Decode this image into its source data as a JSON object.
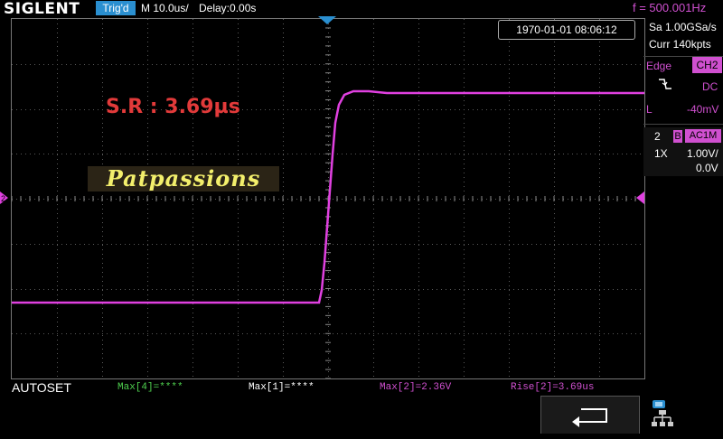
{
  "header": {
    "logo_text": "SIGLENT",
    "trigger_status": "Trig'd",
    "timebase": "M 10.0us/",
    "delay": "Delay:0.00s",
    "frequency": "f = 500.001Hz"
  },
  "screen": {
    "datetime": "1970-01-01 08:06:12",
    "annotation": "S.R : 3.69µs",
    "watermark": "Patpassions",
    "trace_color": "#e040e0",
    "grid_color": "#5a5a5a"
  },
  "right_panel": {
    "sample_rate": "Sa 1.00GSa/s",
    "memory_depth": "Curr 140kpts",
    "trigger": {
      "type_label": "Edge",
      "source": "CH2",
      "slope_icon": "falling-edge-icon",
      "coupling": "DC",
      "level_label": "L",
      "level_value": "-40mV"
    },
    "channel": {
      "number": "2",
      "bw_limit": "B",
      "coupling": "AC1M",
      "probe": "1X",
      "scale": "1.00V/",
      "offset": "0.0V"
    }
  },
  "bottom": {
    "softkey_label": "AUTOSET",
    "measurements": [
      {
        "label": "Max[4]=****",
        "color": "#4fd14f"
      },
      {
        "label": "Max[1]=****",
        "color": "#ffffff"
      },
      {
        "label": "Max[2]=2.36V",
        "color": "#d050d0"
      },
      {
        "label": "Rise[2]=3.69us",
        "color": "#d050d0"
      }
    ],
    "back_icon": "return-arrow-icon",
    "network_icon": "network-icon"
  },
  "colors": {
    "accent_blue": "#2a8fd0",
    "channel2_magenta": "#d050d0",
    "annotation_red": "#e23a3a",
    "watermark_yellow": "#f3ef6c"
  }
}
